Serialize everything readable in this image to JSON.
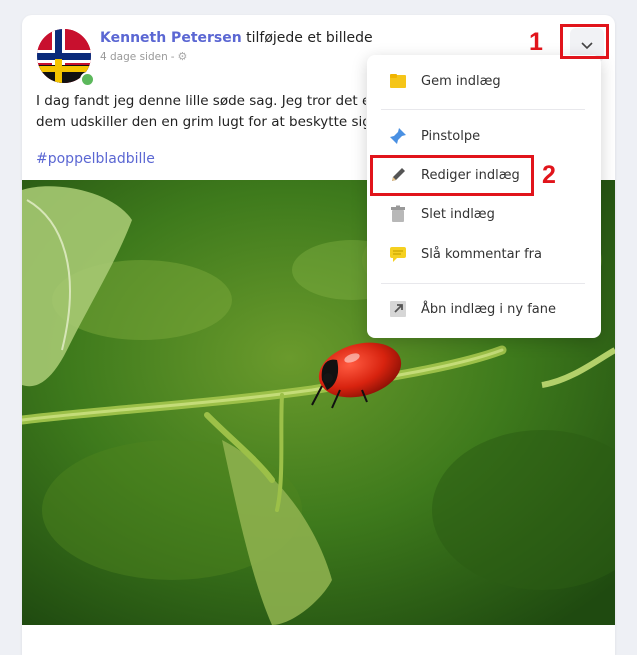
{
  "post": {
    "author": "Kenneth Petersen",
    "action": " tilføjede et billede",
    "time": "4 dage siden",
    "separator": "-",
    "text_line1": "I dag fandt jeg denne lille søde sag. Jeg tror det e",
    "text_line2": "dem udskiller den en grim lugt for at beskytte sig",
    "hashtag": "#poppelbladbille",
    "photo_subject": "red-beetle-on-green-stem"
  },
  "menu": {
    "items": [
      {
        "label": "Gem indlæg",
        "icon": "folder-icon"
      },
      {
        "label": "Pinstolpe",
        "icon": "pin-icon"
      },
      {
        "label": "Rediger indlæg",
        "icon": "pencil-icon"
      },
      {
        "label": "Slet indlæg",
        "icon": "trash-icon"
      },
      {
        "label": "Slå kommentar fra",
        "icon": "comment-icon"
      },
      {
        "label": "Åbn indlæg i ny fane",
        "icon": "external-link-icon"
      }
    ]
  },
  "annotations": {
    "step1": "1",
    "step2": "2",
    "color": "#e1141b"
  },
  "colors": {
    "accent": "#5b67d3",
    "online": "#5cb85c"
  }
}
